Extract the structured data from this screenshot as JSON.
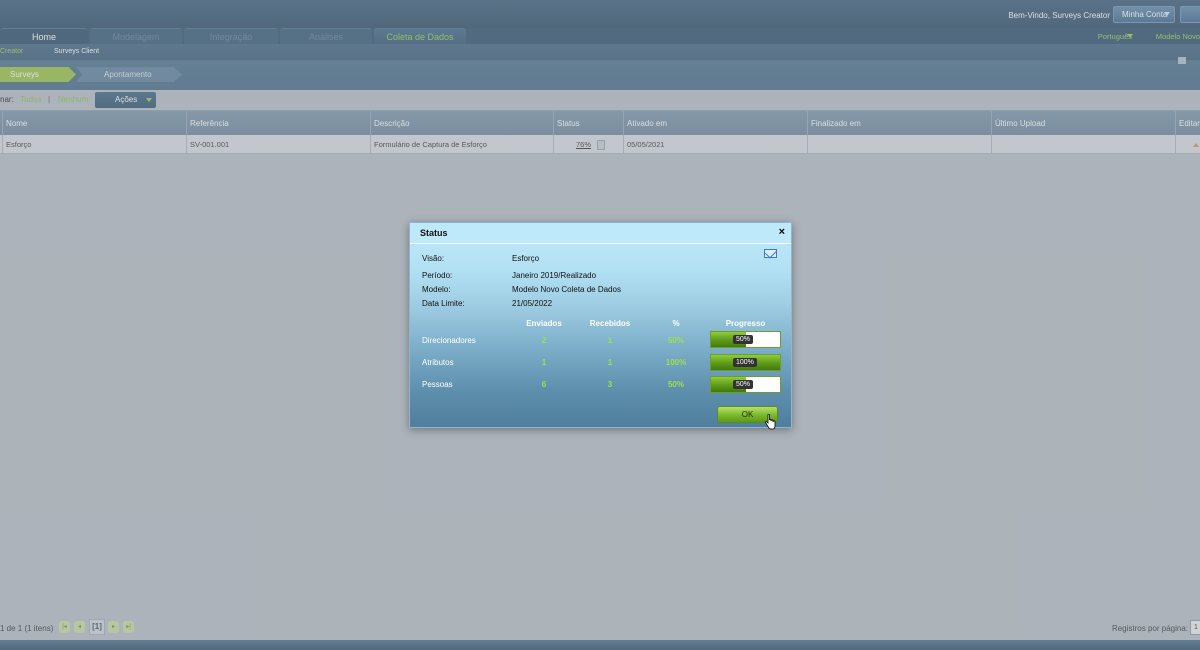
{
  "header": {
    "welcome": "Bem-Vindo, Surveys Creator",
    "account_label": "Minha Conta",
    "language": "Português",
    "model_name": "Modelo Novo"
  },
  "nav": {
    "tabs": [
      {
        "label": "Home"
      },
      {
        "label": "Modelagem"
      },
      {
        "label": "Integração"
      },
      {
        "label": "Análises"
      },
      {
        "label": "Coleta de Dados"
      }
    ]
  },
  "subnav": {
    "creator": "Creator",
    "client": "Surveys Client"
  },
  "breadcrumb": {
    "step1": "Surveys",
    "step2": "Apontamento"
  },
  "toolbar": {
    "select_label": "nar:",
    "all": "Todos",
    "separator": "|",
    "none": "Nenhum",
    "actions": "Ações"
  },
  "table": {
    "columns": [
      "Nome",
      "Referência",
      "Descrição",
      "Status",
      "Ativado em",
      "Finalizado em",
      "Último Upload",
      "Editar"
    ],
    "rows": [
      {
        "nome": "Esforço",
        "referencia": "SV-001.001",
        "descricao": "Formulário de Captura de Esforço",
        "status": "76%",
        "ativado": "05/05/2021",
        "finalizado": "",
        "upload": ""
      }
    ]
  },
  "footer": {
    "pager_text": "1 de 1 (1 itens)",
    "current_page": "[1]",
    "per_page_label": "Registros por página:",
    "per_page_value": "1"
  },
  "dialog": {
    "title": "Status",
    "close": "×",
    "info": [
      {
        "label": "Visão:",
        "value": "Esforço"
      },
      {
        "label": "Período:",
        "value": "Janeiro 2019/Realizado"
      },
      {
        "label": "Modelo:",
        "value": "Modelo Novo Coleta de Dados"
      },
      {
        "label": "Data Limite:",
        "value": "21/05/2022"
      }
    ],
    "headers": {
      "sent": "Enviados",
      "received": "Recebidos",
      "pct": "%",
      "progress": "Progresso"
    },
    "rows": [
      {
        "label": "Direcionadores",
        "sent": "2",
        "received": "1",
        "pct": "50%",
        "progress": 0.5,
        "progress_label": "50%"
      },
      {
        "label": "Atributos",
        "sent": "1",
        "received": "1",
        "pct": "100%",
        "progress": 1.0,
        "progress_label": "100%"
      },
      {
        "label": "Pessoas",
        "sent": "6",
        "received": "3",
        "pct": "50%",
        "progress": 0.5,
        "progress_label": "50%"
      }
    ],
    "ok_label": "OK"
  },
  "colors": {
    "accent_green": "#9ccd4a",
    "header_blue": "#2d4a64",
    "dialog_top": "#bfe9f9"
  }
}
